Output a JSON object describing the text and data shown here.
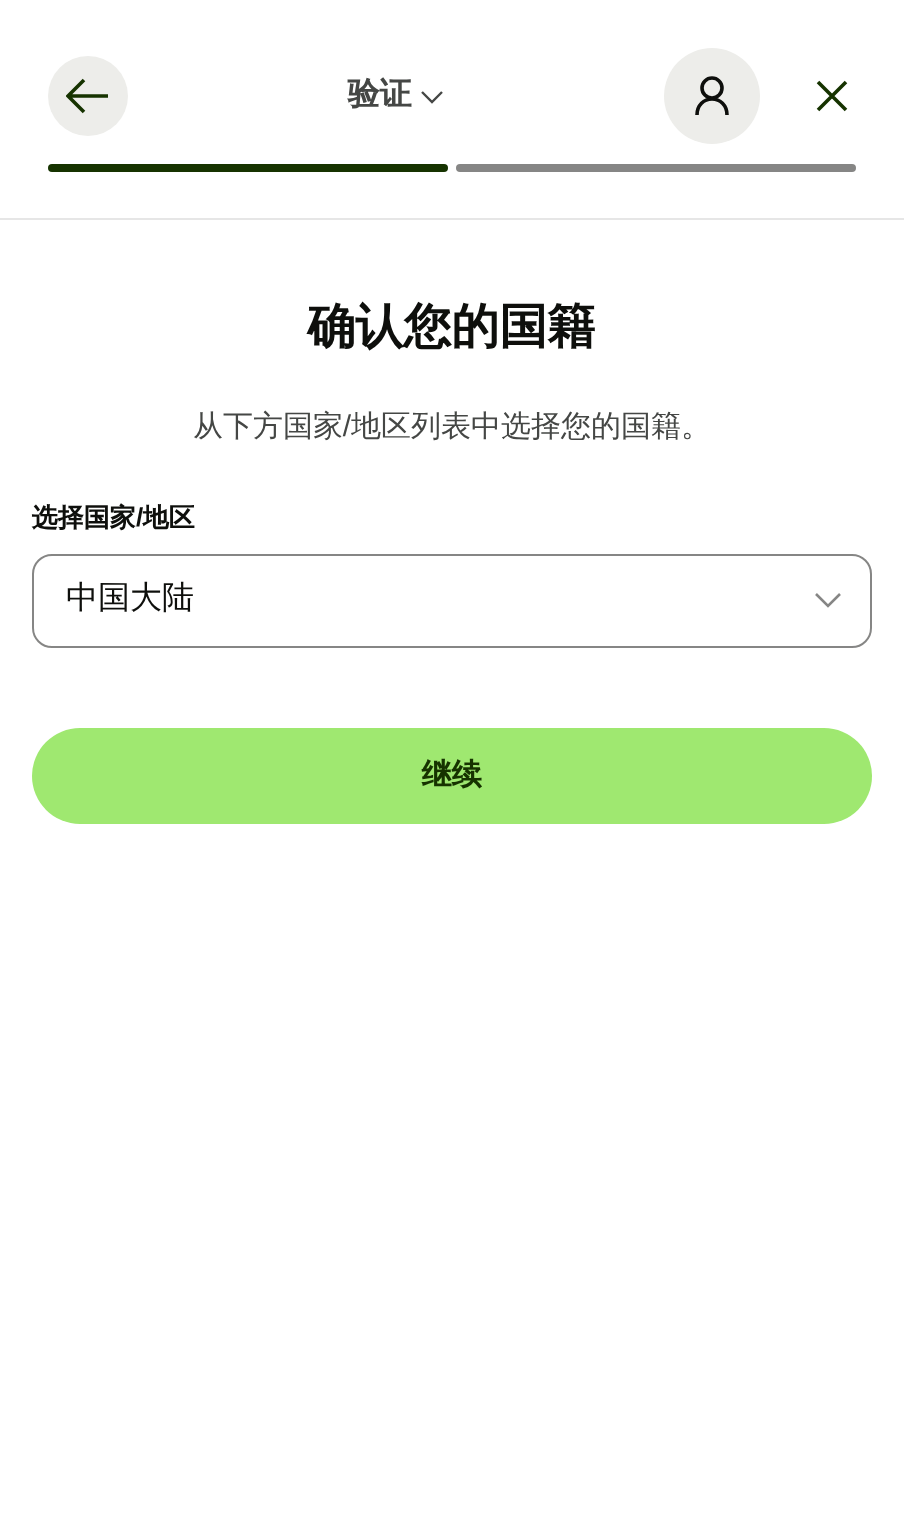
{
  "header": {
    "title": "验证"
  },
  "progress": [
    {
      "level": 1
    },
    {
      "level": 0
    }
  ],
  "heading": "确认您的国籍",
  "subtitle": "从下方国家/地区列表中选择您的国籍。",
  "country_field": {
    "label": "选择国家/地区",
    "value": "中国大陆"
  },
  "continue_button": "继续"
}
